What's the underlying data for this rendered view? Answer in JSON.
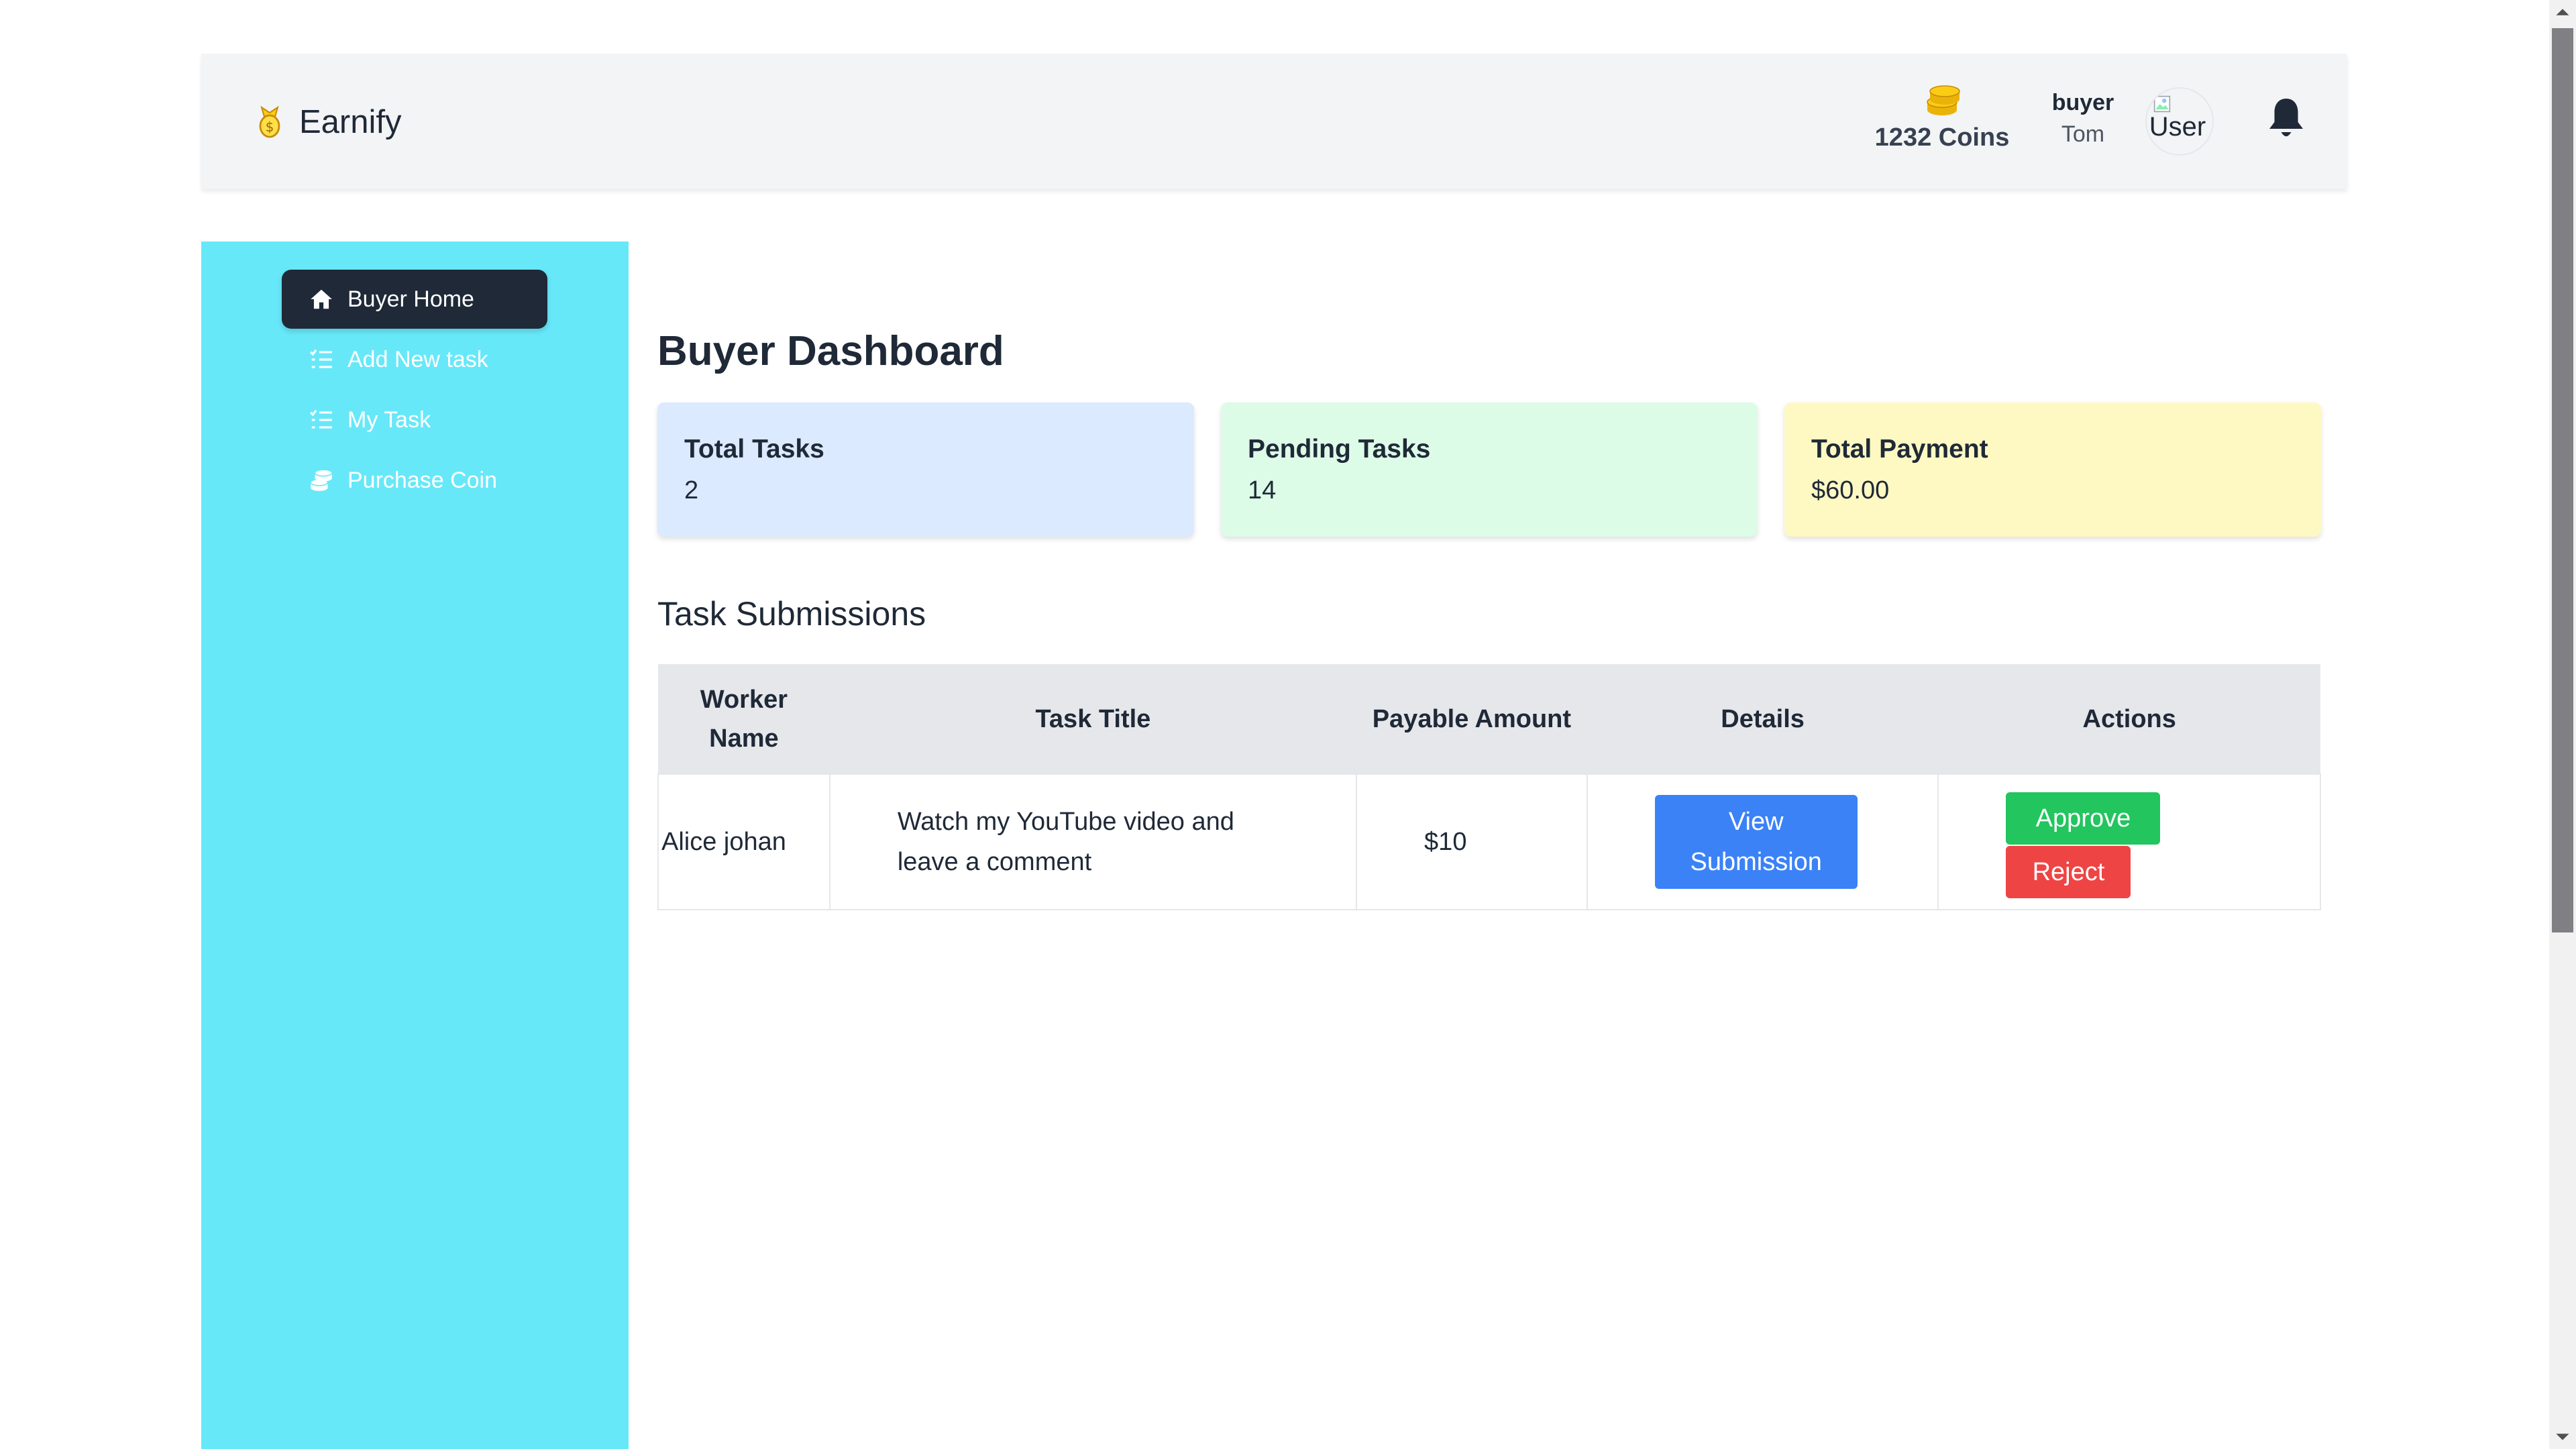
{
  "header": {
    "brand": "Earnify",
    "coins": "1232 Coins",
    "user_role": "buyer",
    "user_name": "Tom",
    "avatar_alt": "User"
  },
  "sidebar": {
    "items": [
      {
        "label": "Buyer Home",
        "icon": "home-icon",
        "active": true
      },
      {
        "label": "Add New task",
        "icon": "list-icon"
      },
      {
        "label": "My Task",
        "icon": "list-icon"
      },
      {
        "label": "Purchase Coin",
        "icon": "coins-icon"
      }
    ]
  },
  "main": {
    "title": "Buyer Dashboard",
    "cards": [
      {
        "label": "Total Tasks",
        "value": "2",
        "color": "#dbeafe"
      },
      {
        "label": "Pending Tasks",
        "value": "14",
        "color": "#dcfce7"
      },
      {
        "label": "Total Payment",
        "value": "$60.00",
        "color": "#fef9c3"
      }
    ],
    "section_title": "Task Submissions",
    "table": {
      "headers": [
        "Worker Name",
        "Task Title",
        "Payable Amount",
        "Details",
        "Actions"
      ],
      "rows": [
        {
          "worker": "Alice johan",
          "task": "Watch my YouTube video and leave a comment",
          "amount": "$10",
          "details_label": "View Submission",
          "approve_label": "Approve",
          "reject_label": "Reject"
        }
      ]
    }
  },
  "colors": {
    "sidebar_bg": "#67e8f9",
    "active_nav": "#1f2937",
    "view_button": "#3b82f6",
    "approve_button": "#22c55e",
    "reject_button": "#ef4444"
  }
}
